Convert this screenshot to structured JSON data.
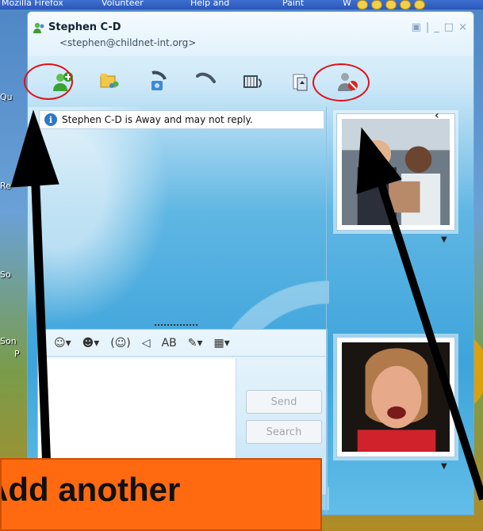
{
  "taskbar": {
    "items": [
      "Mozilla Firefox",
      "Volunteer",
      "Help and",
      "Paint",
      "W"
    ]
  },
  "desktop_labels": [
    "Qu",
    "Re",
    "So",
    "Son",
    "P"
  ],
  "window": {
    "contact_name": "Stephen C-D",
    "contact_email": "<stephen@childnet-int.org>",
    "controls": [
      "▣",
      "|",
      "_",
      "□",
      "×"
    ]
  },
  "toolbar": {
    "buttons": [
      {
        "icon": "add-contact-icon"
      },
      {
        "icon": "share-folders-icon"
      },
      {
        "icon": "video-call-icon"
      },
      {
        "icon": "phone-call-icon"
      },
      {
        "icon": "activities-icon"
      },
      {
        "icon": "games-icon"
      },
      {
        "icon": "block-contact-icon"
      }
    ]
  },
  "conversation": {
    "status_notice": "Stephen C-D is Away and may not reply.",
    "info_glyph": "i"
  },
  "compose": {
    "format_buttons": [
      "☺▾",
      "☻▾",
      "(☺)",
      "◁",
      "AB",
      "✎▾",
      "▦▾"
    ],
    "send_label": "Send",
    "search_label": "Search"
  },
  "overlay": {
    "banner_text": "Add another",
    "accent_color": "#e0101a",
    "banner_color": "#ff6a10"
  }
}
